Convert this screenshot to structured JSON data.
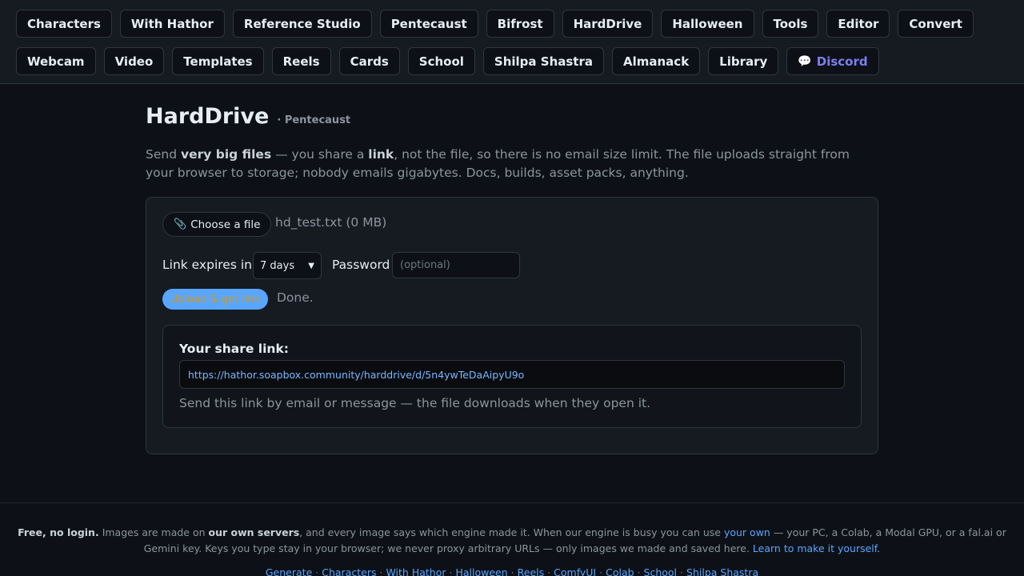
{
  "nav": {
    "row1": [
      "Characters",
      "With Hathor",
      "Reference Studio",
      "Pentecaust",
      "Bifrost",
      "HardDrive",
      "Halloween",
      "Tools",
      "Editor",
      "Convert"
    ],
    "row2": [
      "Webcam",
      "Video",
      "Templates",
      "Reels",
      "Cards",
      "School",
      "Shilpa Shastra",
      "Almanack",
      "Library"
    ],
    "discord_label": "Discord",
    "discord_icon": "💬"
  },
  "page": {
    "title": "HardDrive",
    "subtitle": "· Pentecaust",
    "intro": {
      "p1": "Send ",
      "b1": "very big files",
      "p2": " — you share a ",
      "b2": "link",
      "p3": ", not the file, so there is no email size limit. The file uploads straight from your browser to storage; nobody emails gigabytes. Docs, builds, asset packs, anything."
    }
  },
  "upload": {
    "choose_icon": "📎",
    "choose_label": "Choose a file",
    "filename": "hd_test.txt (0 MB)",
    "expires_label": "Link expires in",
    "expires_value": "7 days",
    "password_label": "Password",
    "password_placeholder": "(optional)",
    "upload_label": "Upload & get link",
    "status": "Done."
  },
  "share": {
    "label": "Your share link:",
    "url": "https://hathor.soapbox.community/harddrive/d/5n4ywTeDaAipyU9o",
    "hint": "Send this link by email or message — the file downloads when they open it."
  },
  "footer": {
    "b1": "Free, no login.",
    "t1": " Images are made on ",
    "b2": "our own servers",
    "t2": ", and every image says which engine made it. When our engine is busy you can use ",
    "link1": "your own",
    "t3": " — your PC, a Colab, a Modal GPU, or a fal.ai or Gemini key. Keys you type stay in your browser; we never proxy arbitrary URLs — only images we made and saved here. ",
    "link2": "Learn to make it yourself.",
    "links": [
      "Generate",
      "Characters",
      "With Hathor",
      "Halloween",
      "Reels",
      "ComfyUI",
      "Colab",
      "School",
      "Shilpa Shastra"
    ]
  },
  "colors": {
    "background": "#0d1117",
    "panel": "#161b22",
    "accent": "#58a6ff",
    "discord": "#7c7ff0",
    "upload_text": "#d29922"
  }
}
